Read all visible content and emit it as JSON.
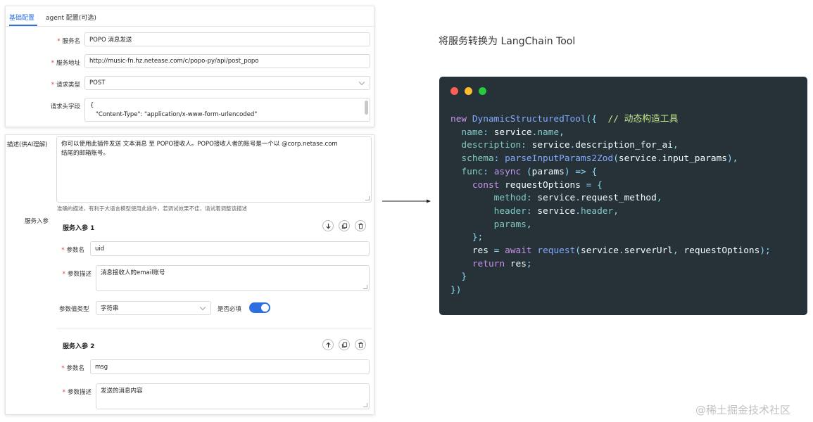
{
  "tabs": [
    {
      "label": "基础配置",
      "active": true
    },
    {
      "label": "agent 配置(可选)",
      "active": false
    }
  ],
  "basic_form": {
    "service_name": {
      "label": "服务名",
      "value": "POPO 消息发送"
    },
    "service_url": {
      "label": "服务地址",
      "value": "http://music-fn.hz.netease.com/c/popo-py/api/post_popo"
    },
    "request_type": {
      "label": "请求类型",
      "value": "POST"
    },
    "headers": {
      "label": "请求头字段",
      "line1": "{",
      "line2": "\"Content-Type\": \"application/x-www-form-urlencoded\""
    }
  },
  "description": {
    "label": "描述(供AI理解)",
    "line1": "你可以使用此插件发送 文本消息 至 POPO接收人。POPO接收人者的账号是一个以 @corp.netase.com",
    "line2": "结尾的邮箱账号。",
    "hint": "准确的描述，有利于大语言模型使用此插件，若调试效果不佳，请试着调整该描述"
  },
  "params_section": {
    "label": "服务入参",
    "params": [
      {
        "title": "服务入参 1",
        "name_label": "参数名",
        "name_value": "uid",
        "desc_label": "参数描述",
        "desc_value": "消息接收人的email账号",
        "type_label": "参数值类型",
        "type_value": "字符串",
        "required_label": "是否必填",
        "required": true
      },
      {
        "title": "服务入参 2",
        "name_label": "参数名",
        "name_value": "msg",
        "desc_label": "参数描述",
        "desc_value": "发送的消息内容"
      }
    ]
  },
  "right": {
    "title": "将服务转换为 LangChain Tool",
    "window_dots": [
      "#ff5f56",
      "#ffbd2e",
      "#27c93f"
    ]
  },
  "code_lines": [
    "new DynamicStructuredTool({  // 动态构造工具",
    "  name: service.name,",
    "  description: service.description_for_ai,",
    "  schema: parseInputParams2Zod(service.input_params),",
    "  func: async (params) => {",
    "    const requestOptions = {",
    "        method: service.request_method,",
    "        header: service.header,",
    "        params,",
    "    };",
    "    res = await request(service.serverUrl, requestOptions);",
    "    return res;",
    "  }",
    "})"
  ],
  "watermark": "@稀土掘金技术社区",
  "colors": {
    "accent": "#2b6fe0",
    "required": "#e53935",
    "code_bg": "#263238"
  }
}
